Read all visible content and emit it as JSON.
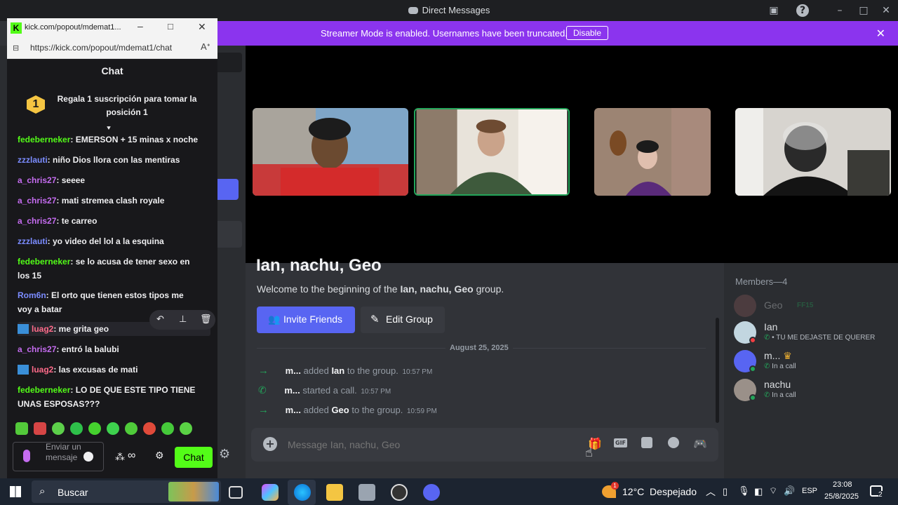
{
  "window_title": "Direct Messages",
  "banner": {
    "message": "Streamer Mode is enabled. Usernames have been truncated.",
    "disable_label": "Disable"
  },
  "group": {
    "title": "Ian, nachu, Geo",
    "welcome_prefix": "Welcome to the beginning of the ",
    "welcome_bold": "Ian, nachu, Geo",
    "welcome_suffix": " group.",
    "invite_label": "Invite Friends",
    "edit_label": "Edit Group",
    "date_divider": "August 25, 2025"
  },
  "events": [
    {
      "actor": "m...",
      "verb": "added",
      "target": "Ian",
      "tail": "to the group.",
      "time": "10:57 PM"
    },
    {
      "actor": "m...",
      "verb": "started a call.",
      "target": "",
      "tail": "",
      "time": "10:57 PM"
    },
    {
      "actor": "m...",
      "verb": "added",
      "target": "Geo",
      "tail": "to the group.",
      "time": "10:59 PM"
    }
  ],
  "composer": {
    "placeholder": "Message Ian, nachu, Geo"
  },
  "members": {
    "header": "Members—4",
    "list": [
      {
        "name": "Geo",
        "status": "FF15"
      },
      {
        "name": "Ian",
        "status": "• TU ME DEJASTE DE QUERER"
      },
      {
        "name": "m...",
        "status": "In a call"
      },
      {
        "name": "nachu",
        "status": "In a call"
      }
    ]
  },
  "popup": {
    "tab_title": "kick.com/popout/mdemat1...",
    "url": "https://kick.com/popout/mdemat1/chat",
    "panel_title": "Chat",
    "gift_rank": "1",
    "gift_text": "Regala 1 suscripción para tomar la posición 1",
    "input_placeholder": "Enviar un mensaje",
    "chat_button": "Chat",
    "messages": [
      {
        "user": "fedeberneker",
        "text": ": EMERSON + 15 minas x noche",
        "color": "#53fc18"
      },
      {
        "user": "zzzlauti",
        "text": ": niño Dios llora con las mentiras",
        "color": "#7b8cff"
      },
      {
        "user": "a_chris27",
        "text": ": seeee",
        "color": "#c56cf0"
      },
      {
        "user": "a_chris27",
        "text": ": mati stremea clash royale",
        "color": "#c56cf0"
      },
      {
        "user": "a_chris27",
        "text": ": te carreo",
        "color": "#c56cf0"
      },
      {
        "user": "zzzlauti",
        "text": ": yo video del lol a la esquina",
        "color": "#7b8cff"
      },
      {
        "user": "fedeberneker",
        "text": ": se lo acusa de tener sexo en los 15",
        "color": "#53fc18"
      },
      {
        "user": "Rom6n",
        "text": ": El orto que tienen estos tipos me voy a batar",
        "color": "#7b8cff"
      },
      {
        "user": "luag2",
        "text": ": me grita geo",
        "color": "#ff6b8a"
      },
      {
        "user": "a_chris27",
        "text": ": entró la balubi",
        "color": "#c56cf0"
      },
      {
        "user": "luag2",
        "text": ": las excusas de mati",
        "color": "#ff6b8a"
      },
      {
        "user": "fedeberneker",
        "text": ": LO DE QUE ESTE TIPO TIENE UNAS ESPOSAS???",
        "color": "#53fc18"
      }
    ]
  },
  "taskbar": {
    "search": "Buscar",
    "weather": "12°C  Despejado",
    "lang": "ESP",
    "time": "23:08",
    "date": "25/8/2025",
    "notif_count": "2",
    "weather_badge": "1"
  }
}
